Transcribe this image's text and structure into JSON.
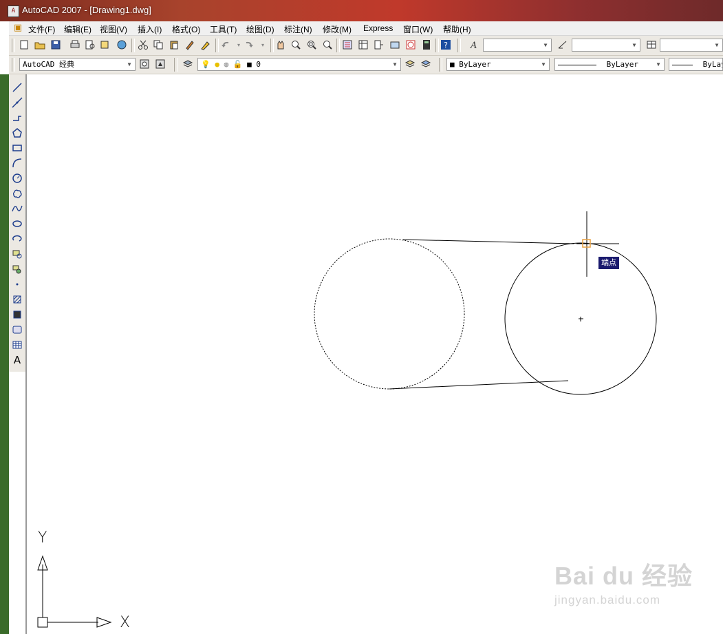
{
  "window": {
    "title": "AutoCAD 2007 - [Drawing1.dwg]",
    "app_icon_text": "A"
  },
  "menu": [
    "文件(F)",
    "编辑(E)",
    "视图(V)",
    "插入(I)",
    "格式(O)",
    "工具(T)",
    "绘图(D)",
    "标注(N)",
    "修改(M)",
    "Express",
    "窗口(W)",
    "帮助(H)"
  ],
  "toolbar2": {
    "workspace": "AutoCAD 经典",
    "layer": "0",
    "color": "ByLayer",
    "linetype": "ByLayer",
    "lineweight": "ByLayer"
  },
  "canvas": {
    "osnap_tooltip": "端点",
    "ucs_x_label": "X",
    "ucs_y_label": "Y"
  },
  "watermark": {
    "logo": "Bai du 经验",
    "url": "jingyan.baidu.com"
  },
  "colors": {
    "tooltip_bg": "#1a1a6e",
    "snap_marker": "#e8a040",
    "canvas_bg": "#ffffff"
  }
}
